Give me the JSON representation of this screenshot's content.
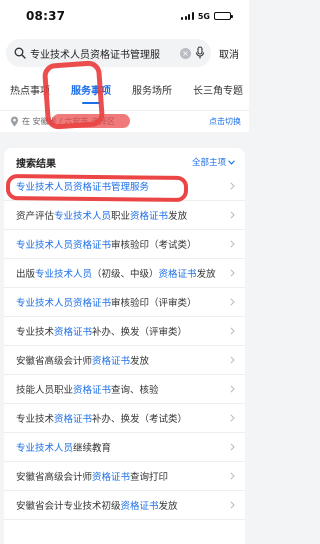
{
  "status_bar": {
    "time": "08:37",
    "network": "5G",
    "battery_level": 0.9
  },
  "search": {
    "query": "专业技术人员资格证书管理服",
    "placeholder": "",
    "cancel_label": "取消",
    "icon": "search-icon"
  },
  "tabs": [
    {
      "label": "热点事项",
      "active": false
    },
    {
      "label": "服务事项",
      "active": true
    },
    {
      "label": "服务场所",
      "active": false
    },
    {
      "label": "长三角专题",
      "active": false
    }
  ],
  "location": {
    "text": "在 安徽省 / 六安市 选择区",
    "switch_label": "点击切换"
  },
  "results": {
    "title": "搜索结果",
    "all_label": "全部主项",
    "items": [
      {
        "text": "专业技术人员资格证书管理服务",
        "highlighted": true
      },
      {
        "text": "资产评估专业技术人员职业资格证书发放",
        "highlighted": false
      },
      {
        "text": "专业技术人员资格证书审核验印（考试类）",
        "highlighted": false
      },
      {
        "text": "出版专业技术人员（初级、中级）资格证书发放",
        "highlighted": false
      },
      {
        "text": "专业技术人员资格证书审核验印（评审类）",
        "highlighted": false
      },
      {
        "text": "专业技术资格证书补办、换发（评审类）",
        "highlighted": false
      },
      {
        "text": "安徽省高级会计师资格证书发放",
        "highlighted": false
      },
      {
        "text": "技能人员职业资格证书查询、核验",
        "highlighted": false
      },
      {
        "text": "专业技术资格证书补办、换发（考试类）",
        "highlighted": false
      },
      {
        "text": "专业技术人员继续教育",
        "highlighted": false
      },
      {
        "text": "安徽省高级会计师资格证书查询打印",
        "highlighted": false
      },
      {
        "text": "安徽省会计专业技术初级资格证书发放",
        "highlighted": false
      }
    ]
  },
  "colors": {
    "accent": "#1c6fe8",
    "annotation": "#ea3b3b",
    "background": "#f3f4f6"
  }
}
